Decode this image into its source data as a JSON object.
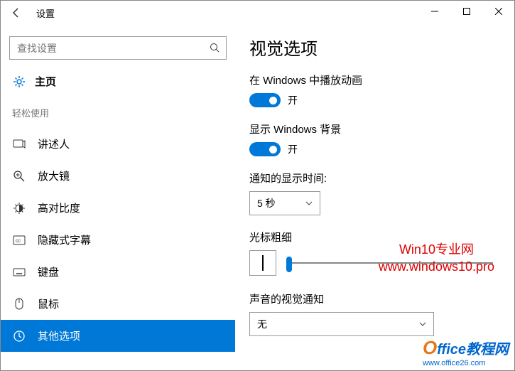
{
  "titlebar": {
    "app_name": "设置"
  },
  "sidebar": {
    "search_placeholder": "查找设置",
    "home_label": "主页",
    "section_label": "轻松使用",
    "items": [
      {
        "label": "讲述人"
      },
      {
        "label": "放大镜"
      },
      {
        "label": "高对比度"
      },
      {
        "label": "隐藏式字幕"
      },
      {
        "label": "键盘"
      },
      {
        "label": "鼠标"
      },
      {
        "label": "其他选项"
      }
    ]
  },
  "main": {
    "title": "视觉选项",
    "anim_label": "在 Windows 中播放动画",
    "anim_state": "开",
    "bg_label": "显示 Windows 背景",
    "bg_state": "开",
    "notify_label": "通知的显示时间:",
    "notify_value": "5 秒",
    "cursor_label": "光标粗细",
    "sound_label": "声音的视觉通知",
    "sound_value": "无"
  },
  "watermark": {
    "line1": "Win10专业网",
    "line2": "www.windows10.pro"
  },
  "footer": {
    "brand_o": "O",
    "brand_main": "ffice教程网",
    "url": "www.office26.com"
  }
}
